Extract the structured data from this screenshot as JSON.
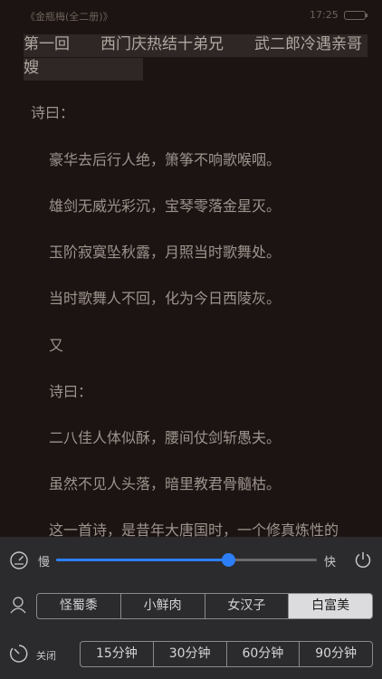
{
  "status": {
    "book_title": "《金瓶梅(全二册)》",
    "time": "17:25"
  },
  "chapter": {
    "title_line1": "第一回　　西门庆热结十弟兄　　武二郎冷遇亲哥",
    "title_line2": "嫂"
  },
  "paragraphs": [
    "诗曰：",
    "豪华去后行人绝，箫筝不响歌喉咽。",
    "雄剑无威光彩沉，宝琴零落金星灭。",
    "玉阶寂寞坠秋露，月照当时歌舞处。",
    "当时歌舞人不回，化为今日西陵灰。",
    "又",
    "诗曰：",
    "二八佳人体似酥，腰间仗剑斩愚夫。",
    "虽然不见人头落，暗里教君骨髓枯。",
    "这一首诗，是昔年大唐国时，一个修真炼性的"
  ],
  "controls": {
    "speed": {
      "slow_label": "慢",
      "fast_label": "快",
      "value_fraction": 0.66
    },
    "voice": {
      "options": [
        "怪蜀黍",
        "小鲜肉",
        "女汉子",
        "白富美"
      ],
      "selected_index": 3
    },
    "timer": {
      "label": "关闭",
      "options": [
        "15分钟",
        "30分钟",
        "60分钟",
        "90分钟"
      ]
    }
  },
  "colors": {
    "page_bg": "#1c1412",
    "panel_bg": "#2b2b2d",
    "accent": "#2d7ff9"
  }
}
